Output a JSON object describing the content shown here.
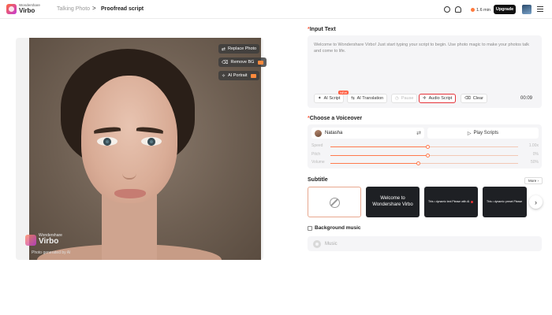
{
  "app": {
    "brand": "Wondershare",
    "name": "Virbo"
  },
  "breadcrumb": {
    "parent": "Talking Photo",
    "separator": ">",
    "current": "Proofread script"
  },
  "header": {
    "help_icon": "help-icon",
    "support_icon": "headset-icon",
    "credits": "1.6 min",
    "upgrade_label": "Upgrade",
    "menu_icon": "menu-icon"
  },
  "photo_panel": {
    "buttons": {
      "replace": "Replace Photo",
      "remove_bg": "Remove BG",
      "ai_portrait": "AI Portrait"
    },
    "watermark": {
      "brand": "Wondershare",
      "name": "Virbo",
      "note": "Photo generated by AI"
    }
  },
  "input_text": {
    "title": "Input Text",
    "script": "Welcome to Wondershare Virbo! Just start typing your script to begin. Use photo magic to make your photos talk and come to life.",
    "tools": {
      "ai_script": "AI Script",
      "new_badge": "NEW",
      "ai_translation": "AI Translation",
      "pause": "Pause",
      "audio_script": "Audio Script",
      "clear": "Clear"
    },
    "duration": "00:09"
  },
  "voiceover": {
    "title": "Choose a Voiceover",
    "voice_name": "Natasha",
    "play_label": "Play Scripts",
    "sliders": [
      {
        "label": "Speed",
        "value": "1.00x",
        "level": 0.52
      },
      {
        "label": "Pitch",
        "value": "0%",
        "level": 0.52
      },
      {
        "label": "Volume",
        "value": "50%",
        "level": 0.47
      }
    ]
  },
  "subtitle": {
    "title": "Subtitle",
    "more_label": "More",
    "card2_line1": "Welcome to",
    "card2_line2": "Wondershare Virbo",
    "card3_text": "This • dynamic text Please with AI",
    "card4_text": "This • dynamic preset Please"
  },
  "background_music": {
    "title": "Background music",
    "music_label": "Music",
    "checked": false
  },
  "colors": {
    "accent": "#ff7a4d",
    "highlight_border": "#e5333a",
    "upgrade_bg": "#111111"
  }
}
